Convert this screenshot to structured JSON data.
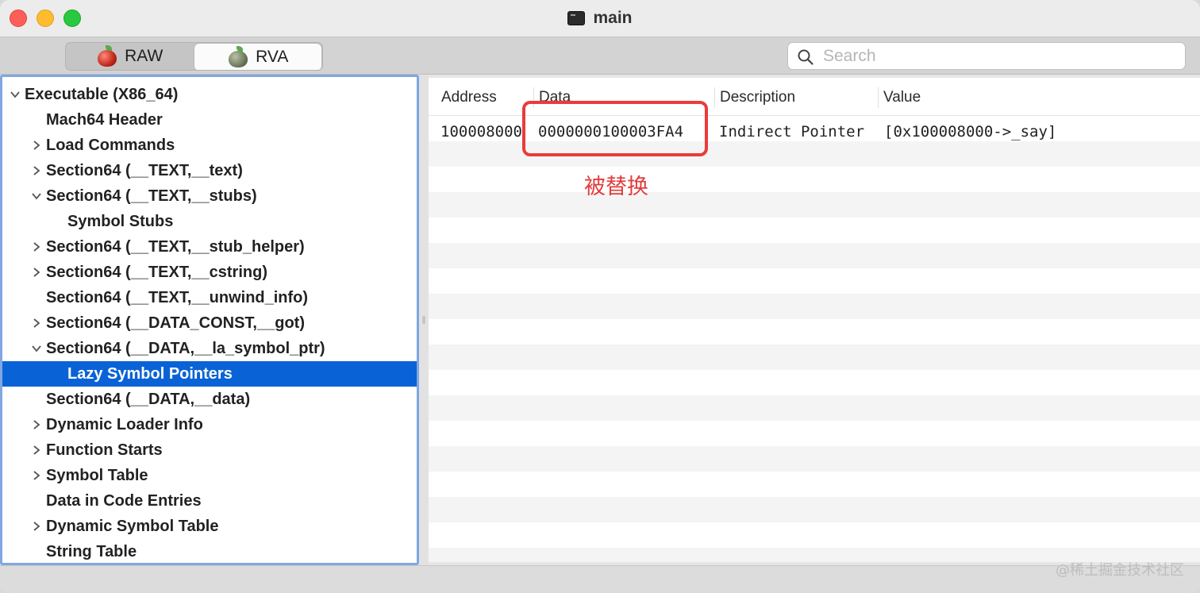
{
  "window": {
    "title": "main"
  },
  "toolbar": {
    "segments": [
      {
        "label": "RAW",
        "active": false
      },
      {
        "label": "RVA",
        "active": true
      }
    ],
    "search": {
      "placeholder": "Search",
      "value": ""
    }
  },
  "tree": [
    {
      "label": "Executable  (X86_64)",
      "expander": "expanded"
    },
    {
      "label": "Mach64 Header",
      "expander": "none"
    },
    {
      "label": "Load Commands",
      "expander": "collapsed"
    },
    {
      "label": "Section64 (__TEXT,__text)",
      "expander": "collapsed"
    },
    {
      "label": "Section64 (__TEXT,__stubs)",
      "expander": "expanded"
    },
    {
      "label": "Symbol Stubs",
      "expander": "none"
    },
    {
      "label": "Section64 (__TEXT,__stub_helper)",
      "expander": "collapsed"
    },
    {
      "label": "Section64 (__TEXT,__cstring)",
      "expander": "collapsed"
    },
    {
      "label": "Section64 (__TEXT,__unwind_info)",
      "expander": "none"
    },
    {
      "label": "Section64 (__DATA_CONST,__got)",
      "expander": "collapsed"
    },
    {
      "label": "Section64 (__DATA,__la_symbol_ptr)",
      "expander": "expanded"
    },
    {
      "label": "Lazy Symbol Pointers",
      "expander": "none",
      "selected": true
    },
    {
      "label": "Section64 (__DATA,__data)",
      "expander": "none"
    },
    {
      "label": "Dynamic Loader Info",
      "expander": "collapsed"
    },
    {
      "label": "Function Starts",
      "expander": "collapsed"
    },
    {
      "label": "Symbol Table",
      "expander": "collapsed"
    },
    {
      "label": "Data in Code Entries",
      "expander": "none"
    },
    {
      "label": "Dynamic Symbol Table",
      "expander": "collapsed"
    },
    {
      "label": "String Table",
      "expander": "none"
    }
  ],
  "table": {
    "columns": [
      "Address",
      "Data",
      "Description",
      "Value"
    ],
    "rows": [
      {
        "address": "100008000",
        "data": "0000000100003FA4",
        "description": "Indirect Pointer",
        "value": "[0x100008000->_say]"
      }
    ]
  },
  "annotation": {
    "text": "被替换",
    "color": "#ea3b3b"
  },
  "watermark": "@稀土掘金技术社区",
  "colors": {
    "selection": "#0a63d6",
    "sidebar_border": "#7fa7e3"
  }
}
